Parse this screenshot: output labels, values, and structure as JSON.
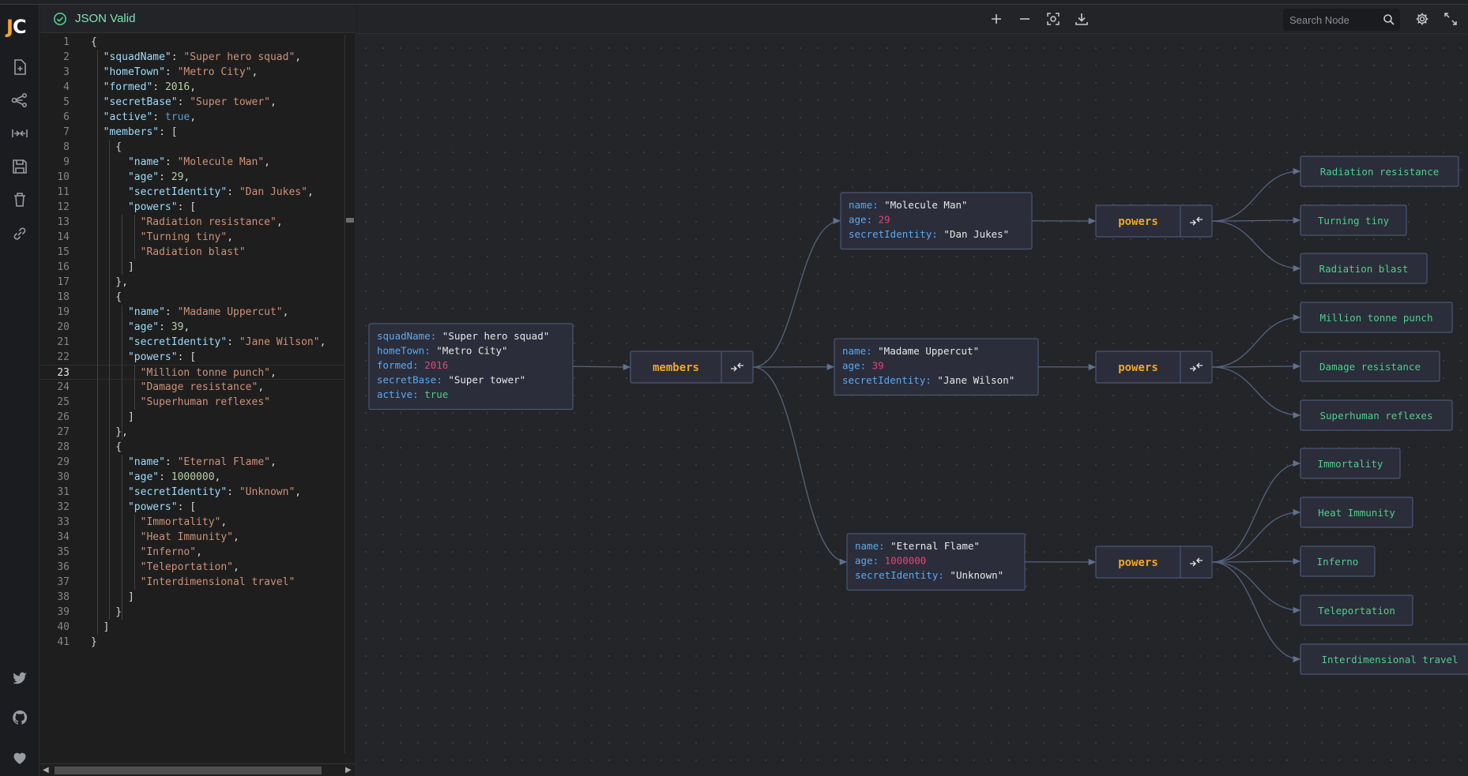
{
  "app": {
    "logo_j": "J",
    "logo_c": "C"
  },
  "sidebar": {
    "top_items": [
      {
        "icon": "file-plus-icon"
      },
      {
        "icon": "share-nodes-icon"
      },
      {
        "icon": "collapse-horizontal-icon"
      },
      {
        "icon": "save-icon"
      },
      {
        "icon": "trash-icon"
      },
      {
        "icon": "link-icon"
      }
    ],
    "bottom_items": [
      {
        "icon": "twitter-icon"
      },
      {
        "icon": "github-icon"
      },
      {
        "icon": "heart-icon"
      }
    ]
  },
  "editor": {
    "status": "JSON Valid",
    "active_line": 23,
    "lines": [
      [
        [
          "p",
          "{"
        ]
      ],
      [
        [
          "k",
          "  \"squadName\""
        ],
        [
          "p",
          ": "
        ],
        [
          "s",
          "\"Super hero squad\""
        ],
        [
          "p",
          ","
        ]
      ],
      [
        [
          "k",
          "  \"homeTown\""
        ],
        [
          "p",
          ": "
        ],
        [
          "s",
          "\"Metro City\""
        ],
        [
          "p",
          ","
        ]
      ],
      [
        [
          "k",
          "  \"formed\""
        ],
        [
          "p",
          ": "
        ],
        [
          "n",
          "2016"
        ],
        [
          "p",
          ","
        ]
      ],
      [
        [
          "k",
          "  \"secretBase\""
        ],
        [
          "p",
          ": "
        ],
        [
          "s",
          "\"Super tower\""
        ],
        [
          "p",
          ","
        ]
      ],
      [
        [
          "k",
          "  \"active\""
        ],
        [
          "p",
          ": "
        ],
        [
          "b",
          "true"
        ],
        [
          "p",
          ","
        ]
      ],
      [
        [
          "k",
          "  \"members\""
        ],
        [
          "p",
          ": ["
        ]
      ],
      [
        [
          "p",
          "    {"
        ]
      ],
      [
        [
          "k",
          "      \"name\""
        ],
        [
          "p",
          ": "
        ],
        [
          "s",
          "\"Molecule Man\""
        ],
        [
          "p",
          ","
        ]
      ],
      [
        [
          "k",
          "      \"age\""
        ],
        [
          "p",
          ": "
        ],
        [
          "n",
          "29"
        ],
        [
          "p",
          ","
        ]
      ],
      [
        [
          "k",
          "      \"secretIdentity\""
        ],
        [
          "p",
          ": "
        ],
        [
          "s",
          "\"Dan Jukes\""
        ],
        [
          "p",
          ","
        ]
      ],
      [
        [
          "k",
          "      \"powers\""
        ],
        [
          "p",
          ": ["
        ]
      ],
      [
        [
          "s",
          "        \"Radiation resistance\""
        ],
        [
          "p",
          ","
        ]
      ],
      [
        [
          "s",
          "        \"Turning tiny\""
        ],
        [
          "p",
          ","
        ]
      ],
      [
        [
          "s",
          "        \"Radiation blast\""
        ]
      ],
      [
        [
          "p",
          "      ]"
        ]
      ],
      [
        [
          "p",
          "    },"
        ]
      ],
      [
        [
          "p",
          "    {"
        ]
      ],
      [
        [
          "k",
          "      \"name\""
        ],
        [
          "p",
          ": "
        ],
        [
          "s",
          "\"Madame Uppercut\""
        ],
        [
          "p",
          ","
        ]
      ],
      [
        [
          "k",
          "      \"age\""
        ],
        [
          "p",
          ": "
        ],
        [
          "n",
          "39"
        ],
        [
          "p",
          ","
        ]
      ],
      [
        [
          "k",
          "      \"secretIdentity\""
        ],
        [
          "p",
          ": "
        ],
        [
          "s",
          "\"Jane Wilson\""
        ],
        [
          "p",
          ","
        ]
      ],
      [
        [
          "k",
          "      \"powers\""
        ],
        [
          "p",
          ": ["
        ]
      ],
      [
        [
          "s",
          "        \"Million tonne punch\""
        ],
        [
          "p",
          ","
        ]
      ],
      [
        [
          "s",
          "        \"Damage resistance\""
        ],
        [
          "p",
          ","
        ]
      ],
      [
        [
          "s",
          "        \"Superhuman reflexes\""
        ]
      ],
      [
        [
          "p",
          "      ]"
        ]
      ],
      [
        [
          "p",
          "    },"
        ]
      ],
      [
        [
          "p",
          "    {"
        ]
      ],
      [
        [
          "k",
          "      \"name\""
        ],
        [
          "p",
          ": "
        ],
        [
          "s",
          "\"Eternal Flame\""
        ],
        [
          "p",
          ","
        ]
      ],
      [
        [
          "k",
          "      \"age\""
        ],
        [
          "p",
          ": "
        ],
        [
          "n",
          "1000000"
        ],
        [
          "p",
          ","
        ]
      ],
      [
        [
          "k",
          "      \"secretIdentity\""
        ],
        [
          "p",
          ": "
        ],
        [
          "s",
          "\"Unknown\""
        ],
        [
          "p",
          ","
        ]
      ],
      [
        [
          "k",
          "      \"powers\""
        ],
        [
          "p",
          ": ["
        ]
      ],
      [
        [
          "s",
          "        \"Immortality\""
        ],
        [
          "p",
          ","
        ]
      ],
      [
        [
          "s",
          "        \"Heat Immunity\""
        ],
        [
          "p",
          ","
        ]
      ],
      [
        [
          "s",
          "        \"Inferno\""
        ],
        [
          "p",
          ","
        ]
      ],
      [
        [
          "s",
          "        \"Teleportation\""
        ],
        [
          "p",
          ","
        ]
      ],
      [
        [
          "s",
          "        \"Interdimensional travel\""
        ]
      ],
      [
        [
          "p",
          "      ]"
        ]
      ],
      [
        [
          "p",
          "    }"
        ]
      ],
      [
        [
          "p",
          "  ]"
        ]
      ],
      [
        [
          "p",
          "}"
        ]
      ]
    ]
  },
  "toolbar": {
    "buttons": [
      "zoom-in-icon",
      "zoom-out-icon",
      "focus-icon",
      "download-icon"
    ],
    "search_placeholder": "Search Node",
    "right_buttons": [
      "settings-gear-icon",
      "fullscreen-icon"
    ]
  },
  "graph": {
    "colors": {
      "key": "#5aa9f5",
      "string": "#e8e8e8",
      "number": "#e8417a",
      "bool": "#4ecf8a",
      "leaf": "#4ecf8a",
      "parent": "#f5a623"
    },
    "root": [
      {
        "key": "squadName",
        "value": "\"Super hero squad\"",
        "type": "string"
      },
      {
        "key": "homeTown",
        "value": "\"Metro City\"",
        "type": "string"
      },
      {
        "key": "formed",
        "value": "2016",
        "type": "number"
      },
      {
        "key": "secretBase",
        "value": "\"Super tower\"",
        "type": "string"
      },
      {
        "key": "active",
        "value": "true",
        "type": "bool"
      }
    ],
    "members_label": "members",
    "powers_label": "powers",
    "members": [
      {
        "fields": [
          {
            "key": "name",
            "value": "\"Molecule Man\"",
            "type": "string"
          },
          {
            "key": "age",
            "value": "29",
            "type": "number"
          },
          {
            "key": "secretIdentity",
            "value": "\"Dan Jukes\"",
            "type": "string"
          }
        ],
        "powers": [
          "Radiation resistance",
          "Turning tiny",
          "Radiation blast"
        ]
      },
      {
        "fields": [
          {
            "key": "name",
            "value": "\"Madame Uppercut\"",
            "type": "string"
          },
          {
            "key": "age",
            "value": "39",
            "type": "number"
          },
          {
            "key": "secretIdentity",
            "value": "\"Jane Wilson\"",
            "type": "string"
          }
        ],
        "powers": [
          "Million tonne punch",
          "Damage resistance",
          "Superhuman reflexes"
        ]
      },
      {
        "fields": [
          {
            "key": "name",
            "value": "\"Eternal Flame\"",
            "type": "string"
          },
          {
            "key": "age",
            "value": "1000000",
            "type": "number"
          },
          {
            "key": "secretIdentity",
            "value": "\"Unknown\"",
            "type": "string"
          }
        ],
        "powers": [
          "Immortality",
          "Heat Immunity",
          "Inferno",
          "Teleportation",
          "Interdimensional travel"
        ]
      }
    ]
  }
}
